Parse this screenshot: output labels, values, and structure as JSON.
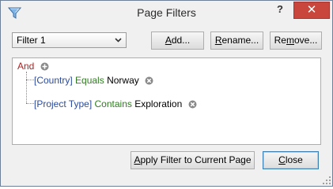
{
  "window": {
    "title": "Page Filters",
    "help_label": "?",
    "close_glyph": "✕"
  },
  "filter_select": {
    "selected": "Filter 1"
  },
  "buttons": {
    "add": {
      "pre": "",
      "u": "A",
      "post": "dd..."
    },
    "rename": {
      "pre": "",
      "u": "R",
      "post": "ename..."
    },
    "remove": {
      "pre": "Re",
      "u": "m",
      "post": "ove..."
    },
    "apply": {
      "pre": "",
      "u": "A",
      "post": "pply Filter to Current Page"
    },
    "close": {
      "pre": "",
      "u": "C",
      "post": "lose"
    }
  },
  "tree": {
    "root": {
      "label": "And"
    },
    "conditions": [
      {
        "field": "[Country]",
        "operator": "Equals",
        "value": "Norway"
      },
      {
        "field": "[Project Type]",
        "operator": "Contains",
        "value": "Exploration"
      }
    ]
  },
  "colors": {
    "close_red": "#c9463d",
    "and_red": "#b22222",
    "field_blue": "#2b4b9b",
    "operator_green": "#2e7d1f"
  },
  "icons": {
    "app": "funnel-icon",
    "add_condition": "plus-circle-icon",
    "remove_condition": "x-circle-icon",
    "dropdown": "chevron-down-icon",
    "resize": "resize-grip-icon"
  }
}
